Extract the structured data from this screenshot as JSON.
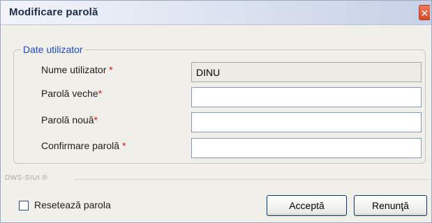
{
  "window": {
    "title": "Modificare parolă",
    "close_glyph": "✕"
  },
  "group": {
    "legend": "Date utilizator",
    "fields": [
      {
        "label": "Nume utilizator",
        "required": "*",
        "value": "DINU",
        "readonly": true
      },
      {
        "label": "Parolă veche",
        "required": "*",
        "value": ""
      },
      {
        "label": "Parolă nouă",
        "required": "*",
        "value": ""
      },
      {
        "label": "Confirmare parolă",
        "required": "*",
        "value": ""
      }
    ]
  },
  "footer": {
    "brand": "DWS-SIUI ®",
    "reset_label": "Resetează parola",
    "reset_checked": false,
    "accept_label": "Acceptă",
    "cancel_label": "Renunţă"
  },
  "colors": {
    "legend": "#1f49c6",
    "required": "#e01010",
    "title_bar": "#dfe5f1"
  }
}
